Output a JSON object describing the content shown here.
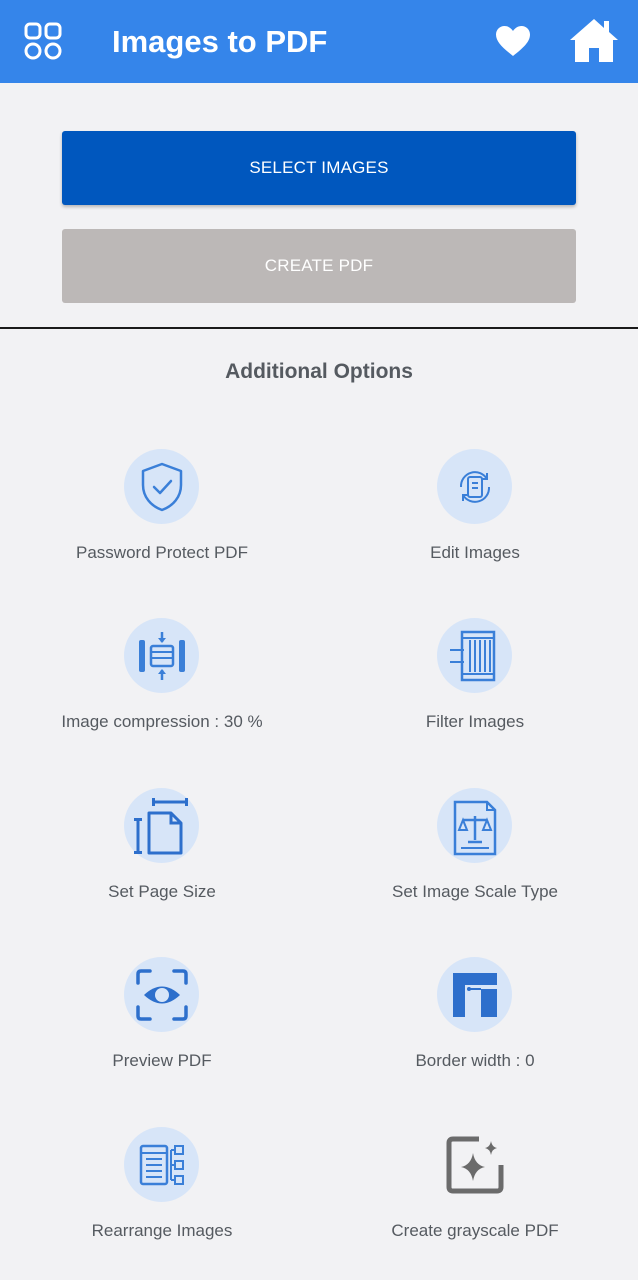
{
  "app_bar": {
    "title": "Images to PDF",
    "background": "#3585ea",
    "left_icon": "grid-icon",
    "right_icons": [
      "heart-icon",
      "home-icon"
    ]
  },
  "actions": {
    "select_images_label": "SELECT IMAGES",
    "create_pdf_label": "CREATE PDF",
    "select_color": "#0057be",
    "create_color": "#bcb8b7"
  },
  "additional": {
    "title": "Additional Options",
    "options": [
      {
        "label": "Password Protect PDF",
        "icon": "shield-check-icon"
      },
      {
        "label": "Edit Images",
        "icon": "edit-images-icon"
      },
      {
        "label": "Image compression : 30 %",
        "icon": "compress-icon"
      },
      {
        "label": "Filter Images",
        "icon": "filter-icon"
      },
      {
        "label": "Set Page Size",
        "icon": "page-size-icon"
      },
      {
        "label": "Set Image Scale Type",
        "icon": "scale-type-icon"
      },
      {
        "label": "Preview PDF",
        "icon": "eye-icon"
      },
      {
        "label": "Border width : 0",
        "icon": "border-icon"
      },
      {
        "label": "Rearrange Images",
        "icon": "rearrange-icon"
      },
      {
        "label": "Create grayscale PDF",
        "icon": "grayscale-icon"
      }
    ]
  }
}
